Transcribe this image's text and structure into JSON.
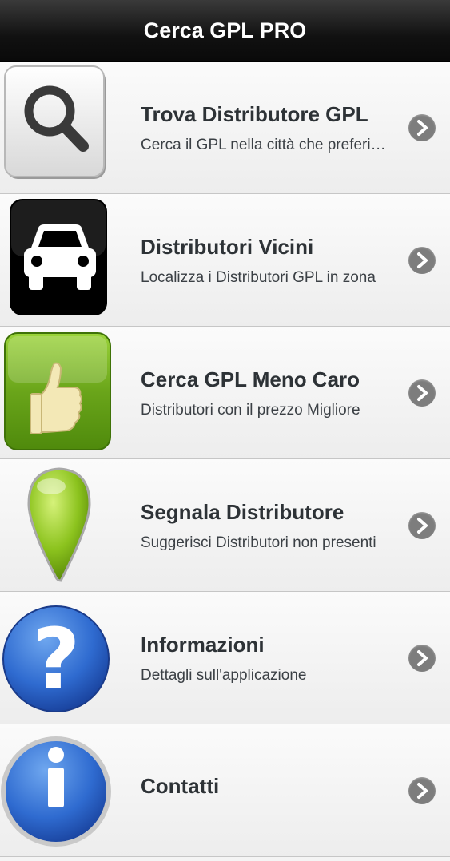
{
  "header": {
    "title": "Cerca GPL PRO"
  },
  "items": [
    {
      "title": "Trova Distributore GPL",
      "subtitle": "Cerca il GPL nella città che preferi…",
      "icon": "magnifier-icon"
    },
    {
      "title": "Distributori Vicini",
      "subtitle": "Localizza i Distributori GPL in zona",
      "icon": "car-icon"
    },
    {
      "title": "Cerca GPL Meno Caro",
      "subtitle": "Distributori con il prezzo Migliore",
      "icon": "thumbs-up-icon"
    },
    {
      "title": "Segnala Distributore",
      "subtitle": "Suggerisci Distributori non presenti",
      "icon": "map-pin-icon"
    },
    {
      "title": "Informazioni",
      "subtitle": "Dettagli sull'applicazione",
      "icon": "question-icon"
    },
    {
      "title": "Contatti",
      "subtitle": "",
      "icon": "info-icon"
    }
  ]
}
